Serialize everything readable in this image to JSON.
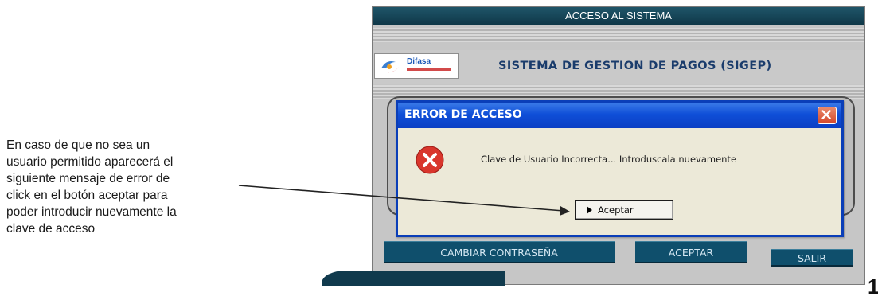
{
  "annotation": {
    "lines": [
      "En caso de que no sea un",
      "usuario permitido  aparecerá el",
      "siguiente mensaje de error de",
      "click en el botón aceptar para",
      "poder introducir nuevamente la",
      "clave de acceso"
    ]
  },
  "app": {
    "title": "ACCESO AL SISTEMA",
    "logo_text": "Difasa",
    "system_name": "SISTEMA DE GESTION DE PAGOS (SIGEP)",
    "buttons": {
      "change_password": "CAMBIAR CONTRASEÑA",
      "accept": "ACEPTAR",
      "exit": "SALIR"
    }
  },
  "dialog": {
    "title": "ERROR DE ACCESO",
    "message": "Clave de Usuario Incorrecta... Introduscala nuevamente",
    "ok_label": "Aceptar",
    "icon": "error-icon",
    "close_icon": "close-icon"
  },
  "page": {
    "number": "1"
  },
  "colors": {
    "app_title_bar": "#0f3848",
    "dialog_title_bar": "#0f4fd8",
    "app_button": "#0f4f6c",
    "dialog_background": "#ece9d8",
    "error_icon": "#d9362c",
    "close_button": "#d5482b"
  }
}
